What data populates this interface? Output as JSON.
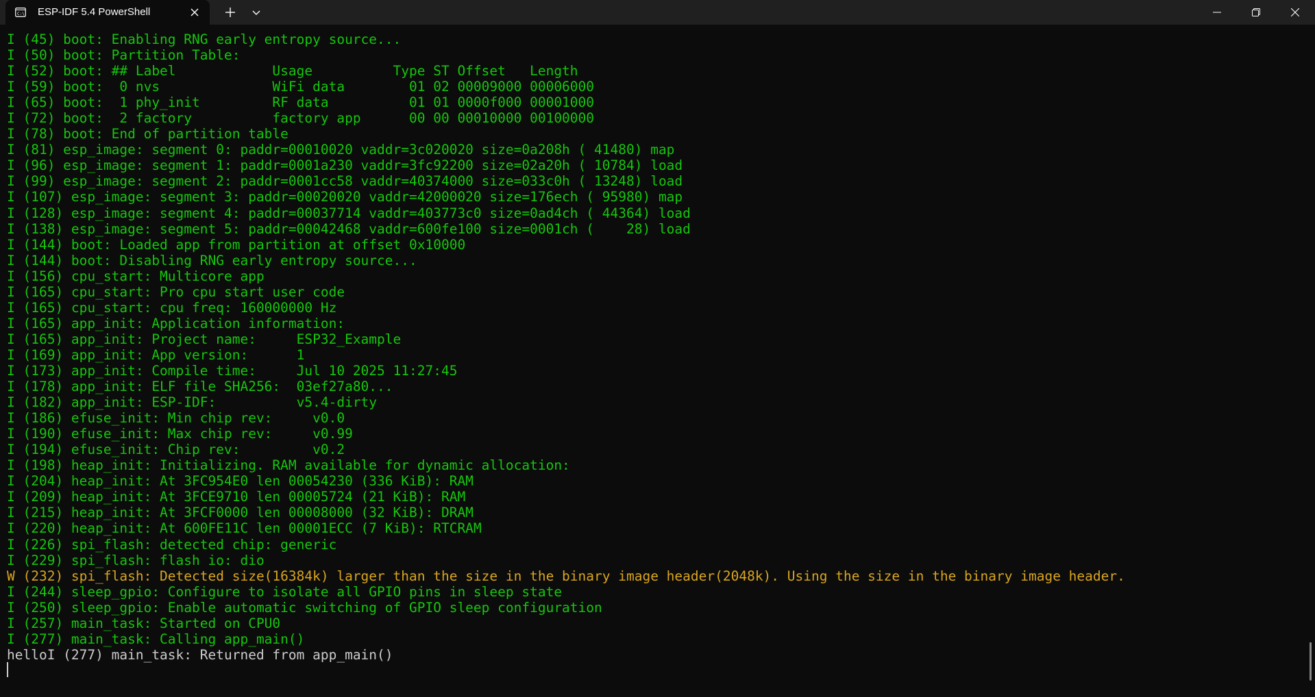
{
  "window": {
    "tab_title": "ESP-IDF 5.4 PowerShell",
    "tab_icon": "terminal-icon",
    "new_tab_icon": "plus-icon",
    "dropdown_icon": "chevron-down-icon",
    "minimize_icon": "minimize-icon",
    "restore_icon": "restore-icon",
    "close_icon": "close-icon"
  },
  "colors": {
    "background": "#0c0c0c",
    "titlebar": "#202020",
    "info_text": "#16c60c",
    "warn_text": "#d9a520",
    "plain_text": "#cccccc"
  },
  "terminal": {
    "lines": [
      {
        "level": "info",
        "text": "I (45) boot: Enabling RNG early entropy source..."
      },
      {
        "level": "info",
        "text": "I (50) boot: Partition Table:"
      },
      {
        "level": "info",
        "text": "I (52) boot: ## Label            Usage          Type ST Offset   Length"
      },
      {
        "level": "info",
        "text": "I (59) boot:  0 nvs              WiFi data        01 02 00009000 00006000"
      },
      {
        "level": "info",
        "text": "I (65) boot:  1 phy_init         RF data          01 01 0000f000 00001000"
      },
      {
        "level": "info",
        "text": "I (72) boot:  2 factory          factory app      00 00 00010000 00100000"
      },
      {
        "level": "info",
        "text": "I (78) boot: End of partition table"
      },
      {
        "level": "info",
        "text": "I (81) esp_image: segment 0: paddr=00010020 vaddr=3c020020 size=0a208h ( 41480) map"
      },
      {
        "level": "info",
        "text": "I (96) esp_image: segment 1: paddr=0001a230 vaddr=3fc92200 size=02a20h ( 10784) load"
      },
      {
        "level": "info",
        "text": "I (99) esp_image: segment 2: paddr=0001cc58 vaddr=40374000 size=033c0h ( 13248) load"
      },
      {
        "level": "info",
        "text": "I (107) esp_image: segment 3: paddr=00020020 vaddr=42000020 size=176ech ( 95980) map"
      },
      {
        "level": "info",
        "text": "I (128) esp_image: segment 4: paddr=00037714 vaddr=403773c0 size=0ad4ch ( 44364) load"
      },
      {
        "level": "info",
        "text": "I (138) esp_image: segment 5: paddr=00042468 vaddr=600fe100 size=0001ch (    28) load"
      },
      {
        "level": "info",
        "text": "I (144) boot: Loaded app from partition at offset 0x10000"
      },
      {
        "level": "info",
        "text": "I (144) boot: Disabling RNG early entropy source..."
      },
      {
        "level": "info",
        "text": "I (156) cpu_start: Multicore app"
      },
      {
        "level": "info",
        "text": "I (165) cpu_start: Pro cpu start user code"
      },
      {
        "level": "info",
        "text": "I (165) cpu_start: cpu freq: 160000000 Hz"
      },
      {
        "level": "info",
        "text": "I (165) app_init: Application information:"
      },
      {
        "level": "info",
        "text": "I (165) app_init: Project name:     ESP32_Example"
      },
      {
        "level": "info",
        "text": "I (169) app_init: App version:      1"
      },
      {
        "level": "info",
        "text": "I (173) app_init: Compile time:     Jul 10 2025 11:27:45"
      },
      {
        "level": "info",
        "text": "I (178) app_init: ELF file SHA256:  03ef27a80..."
      },
      {
        "level": "info",
        "text": "I (182) app_init: ESP-IDF:          v5.4-dirty"
      },
      {
        "level": "info",
        "text": "I (186) efuse_init: Min chip rev:     v0.0"
      },
      {
        "level": "info",
        "text": "I (190) efuse_init: Max chip rev:     v0.99"
      },
      {
        "level": "info",
        "text": "I (194) efuse_init: Chip rev:         v0.2"
      },
      {
        "level": "info",
        "text": "I (198) heap_init: Initializing. RAM available for dynamic allocation:"
      },
      {
        "level": "info",
        "text": "I (204) heap_init: At 3FC954E0 len 00054230 (336 KiB): RAM"
      },
      {
        "level": "info",
        "text": "I (209) heap_init: At 3FCE9710 len 00005724 (21 KiB): RAM"
      },
      {
        "level": "info",
        "text": "I (215) heap_init: At 3FCF0000 len 00008000 (32 KiB): DRAM"
      },
      {
        "level": "info",
        "text": "I (220) heap_init: At 600FE11C len 00001ECC (7 KiB): RTCRAM"
      },
      {
        "level": "info",
        "text": "I (226) spi_flash: detected chip: generic"
      },
      {
        "level": "info",
        "text": "I (229) spi_flash: flash io: dio"
      },
      {
        "level": "warn",
        "text": "W (232) spi_flash: Detected size(16384k) larger than the size in the binary image header(2048k). Using the size in the binary image header."
      },
      {
        "level": "info",
        "text": "I (244) sleep_gpio: Configure to isolate all GPIO pins in sleep state"
      },
      {
        "level": "info",
        "text": "I (250) sleep_gpio: Enable automatic switching of GPIO sleep configuration"
      },
      {
        "level": "info",
        "text": "I (257) main_task: Started on CPU0"
      },
      {
        "level": "info",
        "text": "I (277) main_task: Calling app_main()"
      },
      {
        "level": "plain",
        "text": "helloI (277) main_task: Returned from app_main()"
      }
    ]
  }
}
